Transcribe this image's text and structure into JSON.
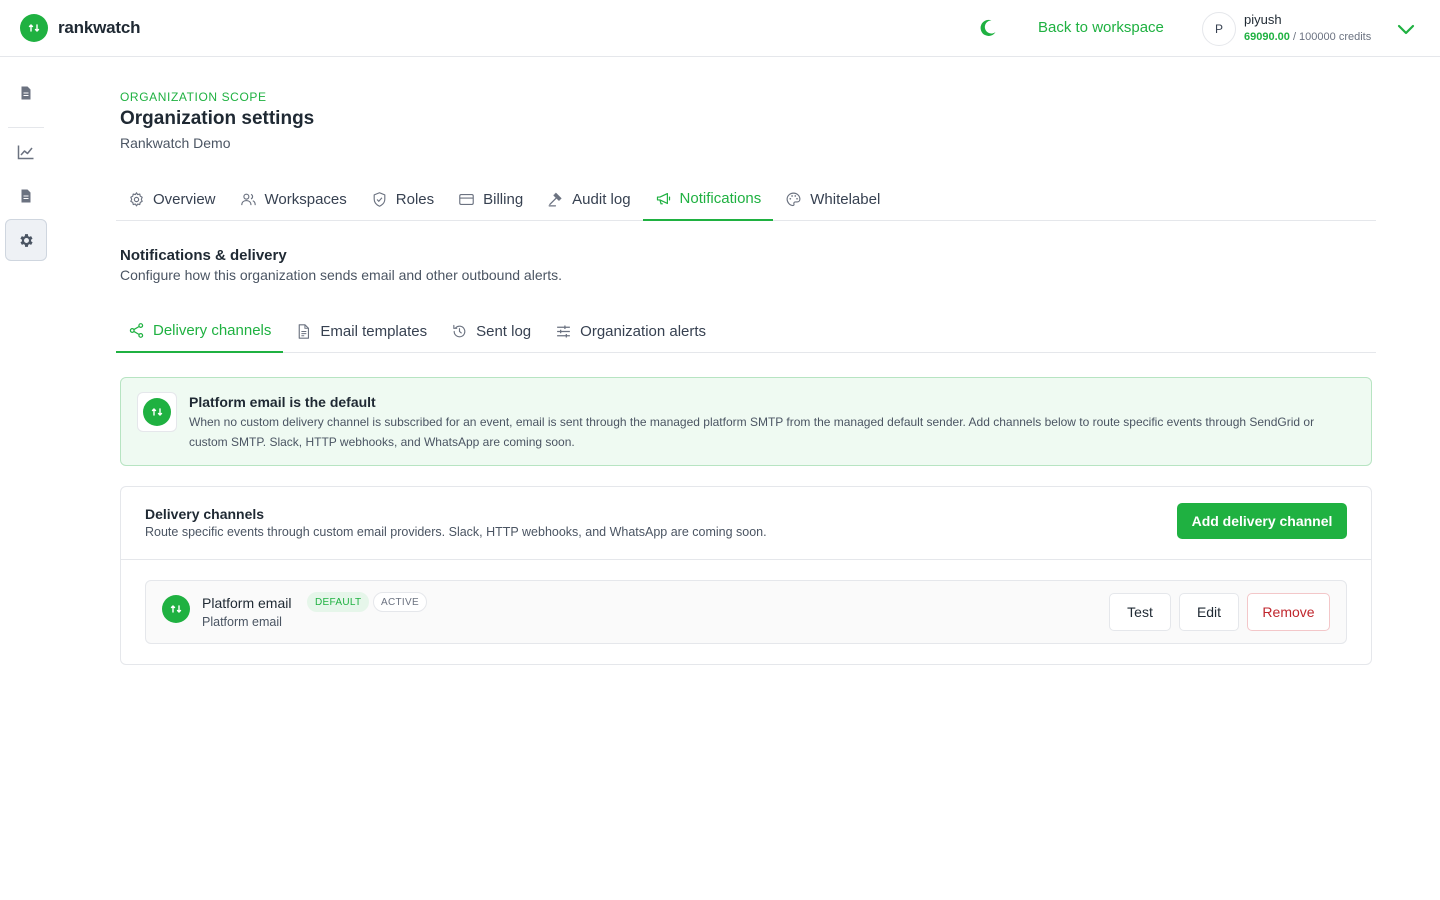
{
  "header": {
    "brand_name": "rankwatch",
    "back_label": "Back to workspace",
    "user": {
      "initial": "P",
      "name": "piyush",
      "credits_used": "69090.00",
      "credits_total": " / 100000 credits"
    }
  },
  "sidebar": {
    "items": [
      {
        "icon": "document-icon"
      },
      {
        "icon": "chart-line-icon"
      },
      {
        "icon": "document-icon"
      },
      {
        "icon": "gear-icon",
        "active": true
      }
    ]
  },
  "page": {
    "scope": "ORGANIZATION SCOPE",
    "title": "Organization settings",
    "org_name": "Rankwatch Demo"
  },
  "tabs": [
    {
      "label": "Overview",
      "icon": "gear-icon"
    },
    {
      "label": "Workspaces",
      "icon": "users-icon"
    },
    {
      "label": "Roles",
      "icon": "shield-icon"
    },
    {
      "label": "Billing",
      "icon": "card-icon"
    },
    {
      "label": "Audit log",
      "icon": "gavel-icon"
    },
    {
      "label": "Notifications",
      "icon": "megaphone-icon",
      "active": true
    },
    {
      "label": "Whitelabel",
      "icon": "palette-icon"
    }
  ],
  "section": {
    "title": "Notifications & delivery",
    "description": "Configure how this organization sends email and other outbound alerts."
  },
  "subtabs": [
    {
      "label": "Delivery channels",
      "icon": "share-icon",
      "active": true
    },
    {
      "label": "Email templates",
      "icon": "file-icon"
    },
    {
      "label": "Sent log",
      "icon": "history-icon"
    },
    {
      "label": "Organization alerts",
      "icon": "sliders-icon"
    }
  ],
  "notice": {
    "title": "Platform email is the default",
    "text": "When no custom delivery channel is subscribed for an event, email is sent through the managed platform SMTP from the managed default sender. Add channels below to route specific events through SendGrid or custom SMTP. Slack, HTTP webhooks, and WhatsApp are coming soon."
  },
  "channels_card": {
    "title": "Delivery channels",
    "description": "Route specific events through custom email providers. Slack, HTTP webhooks, and WhatsApp are coming soon.",
    "add_label": "Add delivery channel",
    "rows": [
      {
        "name": "Platform email",
        "badge_default": "DEFAULT",
        "badge_status": "ACTIVE",
        "subtitle": "Platform email",
        "test_label": "Test",
        "edit_label": "Edit",
        "remove_label": "Remove"
      }
    ]
  },
  "colors": {
    "accent": "#1fb141",
    "danger": "#c0262d",
    "notice_bg": "#effaf2"
  }
}
